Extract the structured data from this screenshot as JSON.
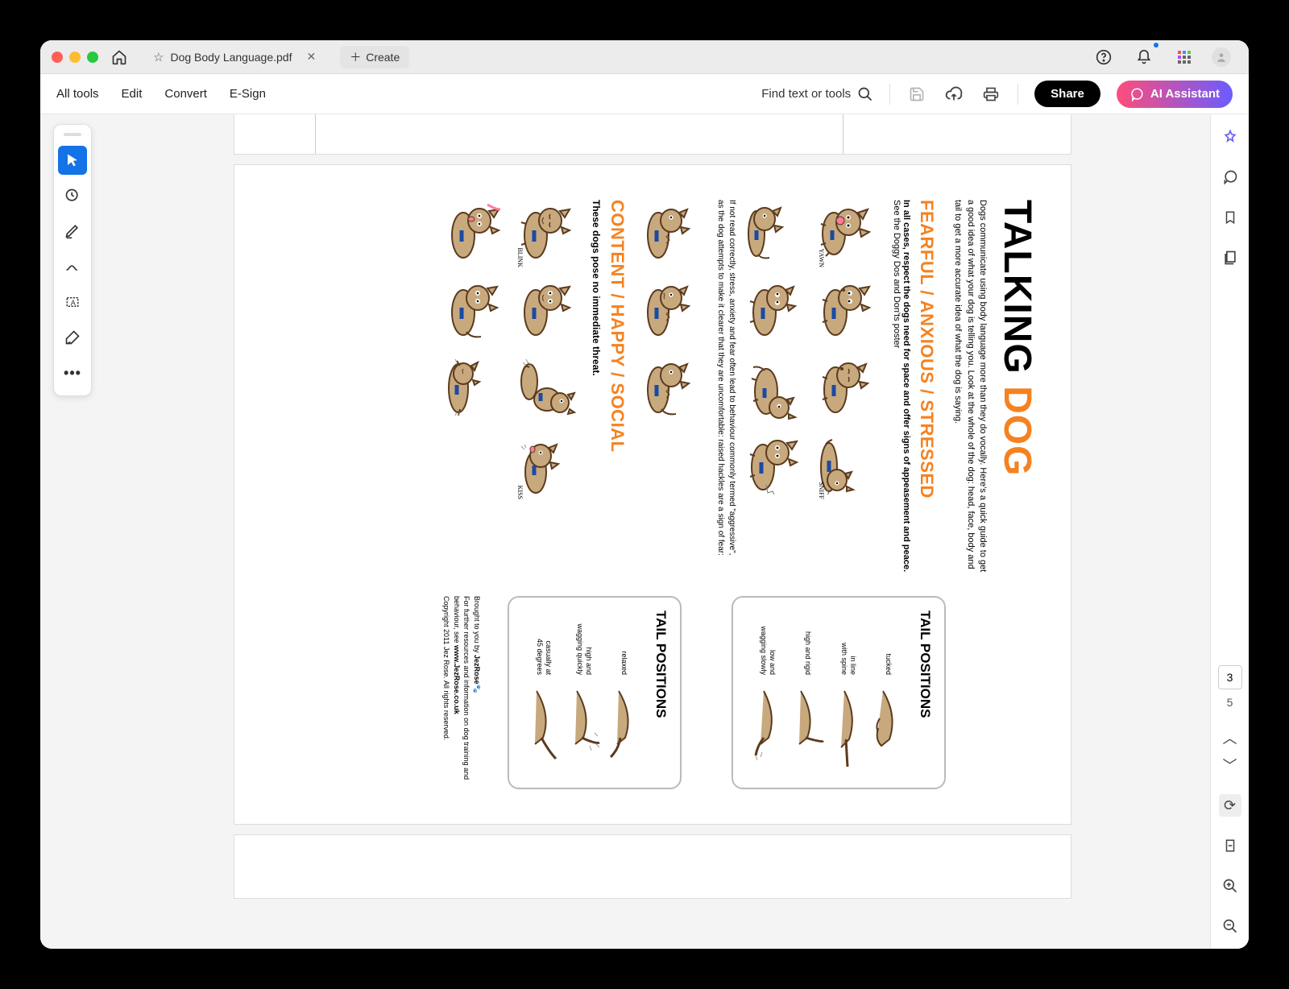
{
  "titlebar": {
    "tab_name": "Dog Body Language.pdf",
    "create_label": "Create"
  },
  "toolbar": {
    "menu": [
      "All tools",
      "Edit",
      "Convert",
      "E-Sign"
    ],
    "find_label": "Find text or tools",
    "share_label": "Share",
    "ai_label": "AI Assistant"
  },
  "pages": {
    "current": "3",
    "total": "5"
  },
  "doc": {
    "title_a": "TALKING ",
    "title_b": "DOG",
    "intro": "Dogs communicate using body language more than they do vocally. Here's a quick guide to get a good idea of what your dog is telling you. Look at the whole of the dog: head, face, body and tail to get a more accurate idea of what the dog is saying.",
    "sect1_title": "FEARFUL / ANXIOUS / STRESSED",
    "sect1_bold": "In all cases, respect the dogs need for space and offer signs of appeasement and peace.",
    "sect1_note": " See the Doggy Dos and Don'ts poster",
    "labels": {
      "yawn": "YAWN",
      "sniff": "SNIFF",
      "blink": "BLINK",
      "kiss": "KISS"
    },
    "sect1_caption": "If not read correctly, stress, anxiety and fear often lead to behaviour commonly termed \"aggressive\", as the dog attempts to make it clearer that they are uncomfortable: raised hackles are a sign of fear:",
    "sect2_title": "CONTENT / HAPPY / SOCIAL",
    "sect2_sub": "These dogs pose no immediate threat.",
    "tail_title": "TAIL POSITIONS",
    "tail_stressed": [
      "tucked",
      "in line\nwith spine",
      "high and rigid",
      "low and\nwagging slowly"
    ],
    "tail_happy": [
      "relaxed",
      "high and\nwagging quickly",
      "casually at\n45 degrees"
    ],
    "credit1": "Brought to you by ",
    "credit_brand": "JezRose",
    "credit2": "For further resources and information on dog training and behaviour, see ",
    "credit_url": "www.JezRose.co.uk",
    "credit3": "Copyright 2011 Jez Rose. All rights reserved."
  }
}
